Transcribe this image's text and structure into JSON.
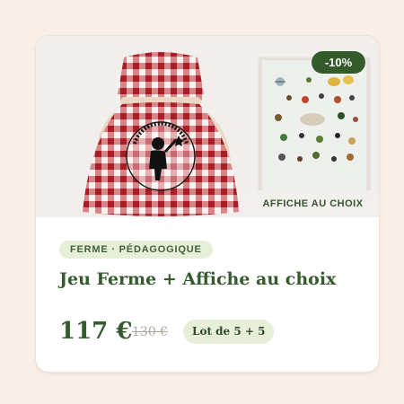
{
  "product": {
    "discount_badge": "-10%",
    "poster_caption": "AFFICHE AU CHOIX",
    "category_tag": "FERME · PÉDAGOGIQUE",
    "title": "Jeu Ferme + Affiche au choix",
    "price": "117 €",
    "old_price": "130 €",
    "bundle_label": "Lot de 5 + 5"
  },
  "images": {
    "bag_logo_text": "PRÉPARATION À L'ÉCRITURE",
    "bag_pattern_color": "#b9262e",
    "poster_illustration": "insect-chart-poster"
  },
  "colors": {
    "brand_green": "#355b2d",
    "tag_background": "#e7efd9",
    "page_background": "#faefe7"
  }
}
